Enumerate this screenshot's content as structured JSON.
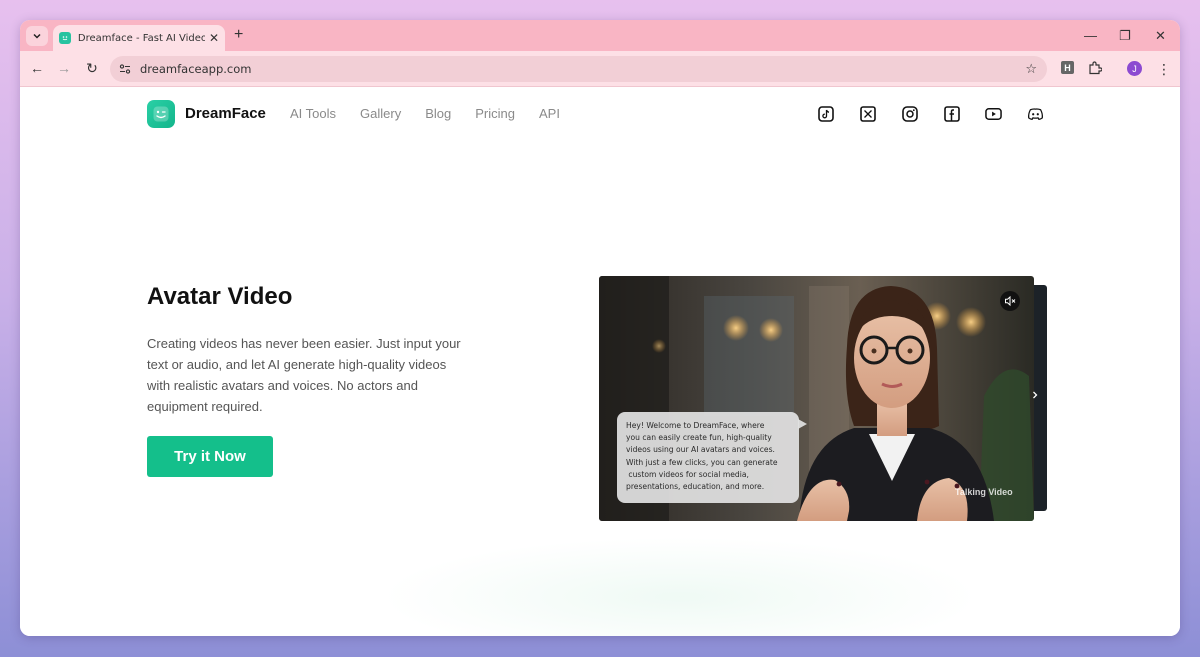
{
  "browser": {
    "tab_title": "Dreamface - Fast AI Video Generator",
    "url": "dreamfaceapp.com",
    "extension_label": "H",
    "profile_initial": "J"
  },
  "site": {
    "brand": "DreamFace",
    "nav": [
      "AI Tools",
      "Gallery",
      "Blog",
      "Pricing",
      "API"
    ],
    "socials": [
      "tiktok-icon",
      "x-icon",
      "instagram-icon",
      "facebook-icon",
      "youtube-icon",
      "discord-icon"
    ]
  },
  "hero": {
    "title": "Avatar Video",
    "description": "Creating videos has never been easier. Just input your text or audio, and let AI generate high-quality videos with realistic avatars and voices. No actors and equipment required.",
    "cta": "Try it Now"
  },
  "video": {
    "bubble_lines": [
      "Hey! Welcome to DreamFace, where",
      "you can easily create fun, high-quality",
      "videos using our AI avatars and voices.",
      "With just a few clicks, you can generate",
      " custom videos for social media,",
      "presentations, education, and more."
    ],
    "label": "Talking Video"
  },
  "colors": {
    "accent": "#14bf8b",
    "tab_strip": "#f9b5c4",
    "toolbar": "#fde0e6"
  }
}
